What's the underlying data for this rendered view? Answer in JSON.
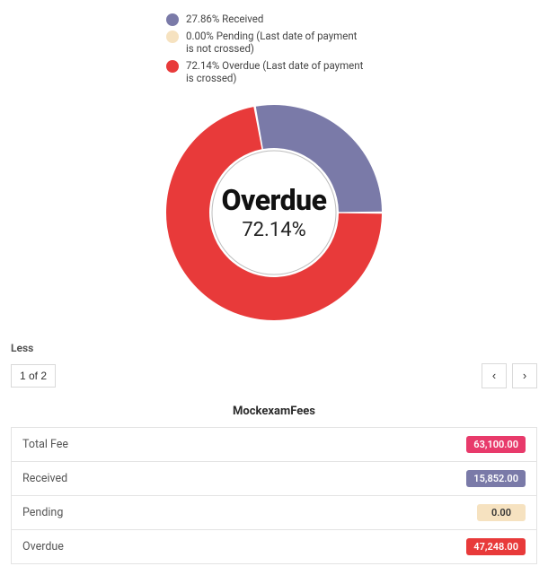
{
  "colors": {
    "received": "#7a7aa8",
    "pending": "#f6e2c0",
    "overdue": "#e83a3a",
    "total": "#e83a6b"
  },
  "chart_data": {
    "type": "pie",
    "title": "",
    "center_label": "Overdue",
    "center_value": "72.14%",
    "series": [
      {
        "name": "Received",
        "value": 27.86,
        "label": "27.86% Received",
        "color": "#7a7aa8"
      },
      {
        "name": "Pending",
        "value": 0.0,
        "label": "0.00% Pending (Last date of payment is not crossed)",
        "color": "#f6e2c0"
      },
      {
        "name": "Overdue",
        "value": 72.14,
        "label": "72.14% Overdue (Last date of payment is crossed)",
        "color": "#e83a3a"
      }
    ]
  },
  "section_label": "Less",
  "pager": {
    "label": "1 of 2",
    "prev": "‹",
    "next": "›"
  },
  "fees": {
    "title": "MockexamFees",
    "rows": [
      {
        "label": "Total Fee",
        "amount": "63,100.00",
        "color_key": "total"
      },
      {
        "label": "Received",
        "amount": "15,852.00",
        "color_key": "received"
      },
      {
        "label": "Pending",
        "amount": "0.00",
        "color_key": "pending"
      },
      {
        "label": "Overdue",
        "amount": "47,248.00",
        "color_key": "overdue"
      }
    ]
  }
}
